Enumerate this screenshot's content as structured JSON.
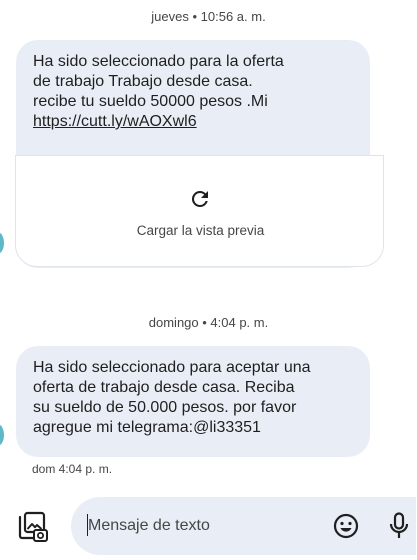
{
  "conversation": {
    "messages": [
      {
        "timestamp_header": "jueves • 10:56 a. m.",
        "text_lines": [
          "Ha sido seleccionado para la oferta",
          "de trabajo Trabajo desde casa.",
          "recibe tu sueldo 50000 pesos .Mi"
        ],
        "link": "https://cutt.ly/wAOXwl6",
        "preview_label": "Cargar la vista previa",
        "preview_icon": "refresh-icon"
      },
      {
        "timestamp_header": "domingo • 4:04 p. m.",
        "text_lines": [
          "Ha sido seleccionado para aceptar una",
          "oferta de trabajo desde casa. Reciba",
          "su sueldo de 50.000 pesos. por favor",
          "agregue mi telegrama:@li33351"
        ],
        "time": "dom 4:04 p. m."
      }
    ]
  },
  "composer": {
    "placeholder": "Mensaje de texto",
    "gallery_icon": "gallery-icon",
    "emoji_icon": "emoji-icon",
    "mic_icon": "mic-icon"
  },
  "colors": {
    "bubble": "#e9eef6",
    "text": "#1f1f1f",
    "secondary_text": "#444746",
    "avatar_accent": "#5fb8c7"
  }
}
